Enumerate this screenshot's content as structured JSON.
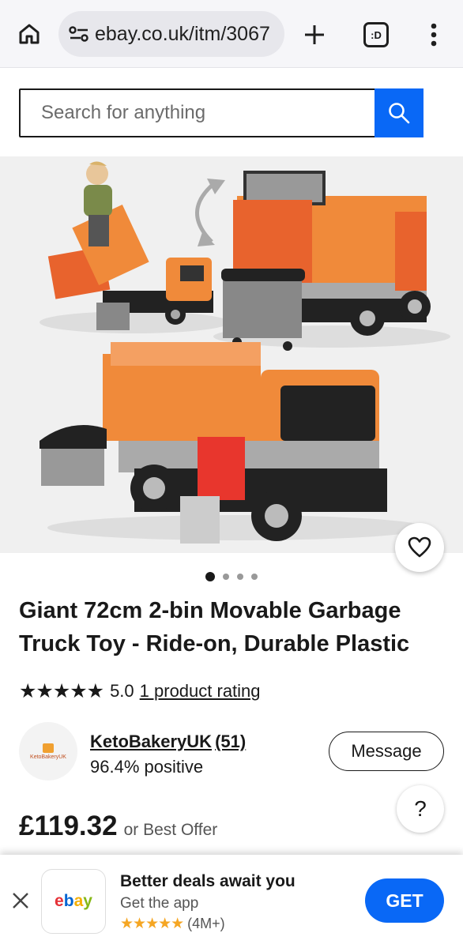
{
  "browser": {
    "url": "ebay.co.uk/itm/3067",
    "tabs_label": ":D"
  },
  "search": {
    "placeholder": "Search for anything"
  },
  "gallery": {
    "total_images": 4,
    "active_index": 0
  },
  "listing": {
    "title": "Giant 72cm 2-bin Movable Garbage Truck Toy - Ride-on, Durable Plastic",
    "stars": "★★★★★",
    "rating_value": "5.0",
    "rating_link": "1 product rating",
    "price": "£119.32",
    "best_offer": "or Best Offer"
  },
  "seller": {
    "name": "KetoBakeryUK",
    "feedback_count": "(51)",
    "positive": "96.4% positive",
    "logo_text": "KetoBakeryUK",
    "message_label": "Message"
  },
  "help": {
    "label": "?"
  },
  "app_banner": {
    "title": "Better deals await you",
    "subtitle": "Get the app",
    "stars": "★★★★★",
    "reviews": "(4M+)",
    "get_label": "GET",
    "icon_letters": [
      "e",
      "b",
      "a",
      "y"
    ]
  },
  "colors": {
    "accent": "#0968f6",
    "truck_orange": "#f08a3a",
    "star_gold": "#f5a623"
  }
}
